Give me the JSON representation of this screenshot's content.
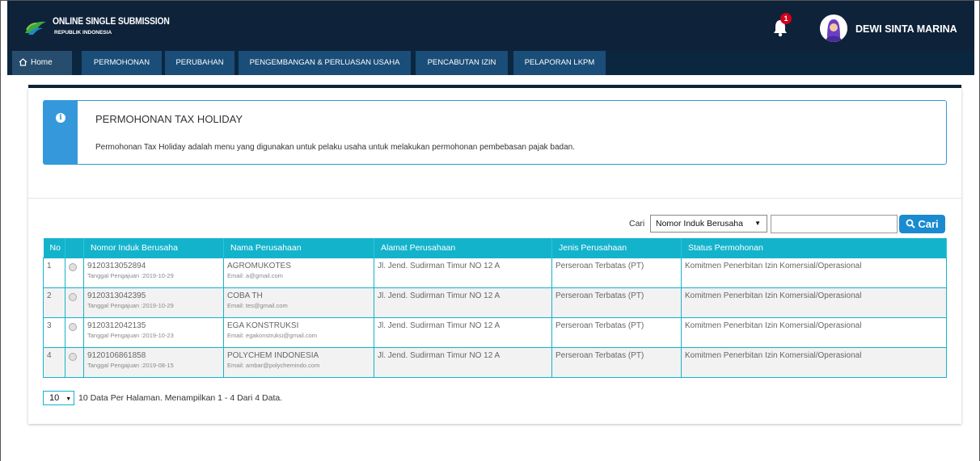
{
  "header": {
    "brand_title": "ONLINE SINGLE SUBMISSION",
    "brand_subtitle": "REPUBLIK INDONESIA",
    "notification_count": "1",
    "user_name": "DEWI SINTA MARINA"
  },
  "nav": {
    "home": "Home",
    "items": [
      "PERMOHONAN",
      "PERUBAHAN",
      "PENGEMBANGAN & PERLUASAN USAHA",
      "PENCABUTAN IZIN",
      "PELAPORAN LKPM"
    ]
  },
  "info": {
    "title": "PERMOHONAN TAX HOLIDAY",
    "description": "Permohonan Tax Holiday adalah menu yang digunakan untuk pelaku usaha untuk melakukan permohonan pembebasan pajak badan."
  },
  "search": {
    "label": "Cari",
    "field_selected": "Nomor Induk Berusaha",
    "input_value": "",
    "button_label": "Cari"
  },
  "table": {
    "columns": [
      "No",
      "Nomor Induk Berusaha",
      "Nama Perusahaan",
      "Alamat Perusahaan",
      "Jenis Perusahaan",
      "Status Permohonan"
    ],
    "rows": [
      {
        "no": "1",
        "nib": "9120313052894",
        "tanggal": "Tanggal Pengajuan :2019-10-29",
        "nama": "AGROMUKOTES",
        "email": "Email: a@gmail.com",
        "alamat": "Jl. Jend. Sudirman Timur NO 12 A",
        "jenis": "Perseroan Terbatas (PT)",
        "status": "Komitmen Penerbitan Izin Komersial/Operasional"
      },
      {
        "no": "2",
        "nib": "9120313042395",
        "tanggal": "Tanggal Pengajuan :2019-10-29",
        "nama": "COBA TH",
        "email": "Email: tes@gmail.com",
        "alamat": "Jl. Jend. Sudirman Timur NO 12 A",
        "jenis": "Perseroan Terbatas (PT)",
        "status": "Komitmen Penerbitan Izin Komersial/Operasional"
      },
      {
        "no": "3",
        "nib": "9120312042135",
        "tanggal": "Tanggal Pengajuan :2019-10-23",
        "nama": "EGA KONSTRUKSI",
        "email": "Email: egakonstruksi@gmail.com",
        "alamat": "Jl. Jend. Sudirman Timur NO 12 A",
        "jenis": "Perseroan Terbatas (PT)",
        "status": "Komitmen Penerbitan Izin Komersial/Operasional"
      },
      {
        "no": "4",
        "nib": "9120106861858",
        "tanggal": "Tanggal Pengajuan :2019-08-15",
        "nama": "POLYCHEM INDONESIA",
        "email": "Email: ambar@polychemindo.com",
        "alamat": "Jl. Jend. Sudirman Timur NO 12 A",
        "jenis": "Perseroan Terbatas (PT)",
        "status": "Komitmen Penerbitan Izin Komersial/Operasional"
      }
    ]
  },
  "paging": {
    "per_page": "10",
    "info": "10 Data Per Halaman. Menampilkan 1 - 4 Dari 4 Data."
  },
  "icons": {
    "logo": "oss-leaf-logo",
    "bell": "bell-icon",
    "avatar": "avatar-icon",
    "info": "info-icon",
    "search": "search-icon",
    "home": "home-icon"
  },
  "colors": {
    "header_bg": "#0e2239",
    "nav_item_bg": "#1a4d78",
    "table_header": "#14b3cc",
    "info_accent": "#3498db",
    "search_button": "#1a8bd1",
    "badge": "#d0021b"
  }
}
